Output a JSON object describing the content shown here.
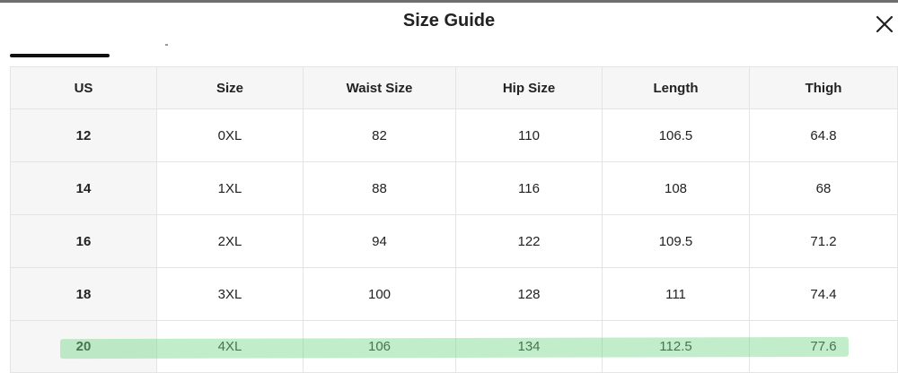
{
  "dialog": {
    "title": "Size Guide",
    "close_icon": "close-icon"
  },
  "table": {
    "headers": [
      "US",
      "Size",
      "Waist Size",
      "Hip Size",
      "Length",
      "Thigh"
    ],
    "rows": [
      [
        "12",
        "0XL",
        "82",
        "110",
        "106.5",
        "64.8"
      ],
      [
        "14",
        "1XL",
        "88",
        "116",
        "108",
        "68"
      ],
      [
        "16",
        "2XL",
        "94",
        "122",
        "109.5",
        "71.2"
      ],
      [
        "18",
        "3XL",
        "100",
        "128",
        "111",
        "74.4"
      ],
      [
        "20",
        "4XL",
        "106",
        "134",
        "112.5",
        "77.6"
      ]
    ]
  },
  "highlight": {
    "row_index": 4,
    "color": "#78d68c"
  },
  "colors": {
    "header_bg": "#f6f6f6",
    "border": "#e4e4e4",
    "text": "#222222"
  }
}
